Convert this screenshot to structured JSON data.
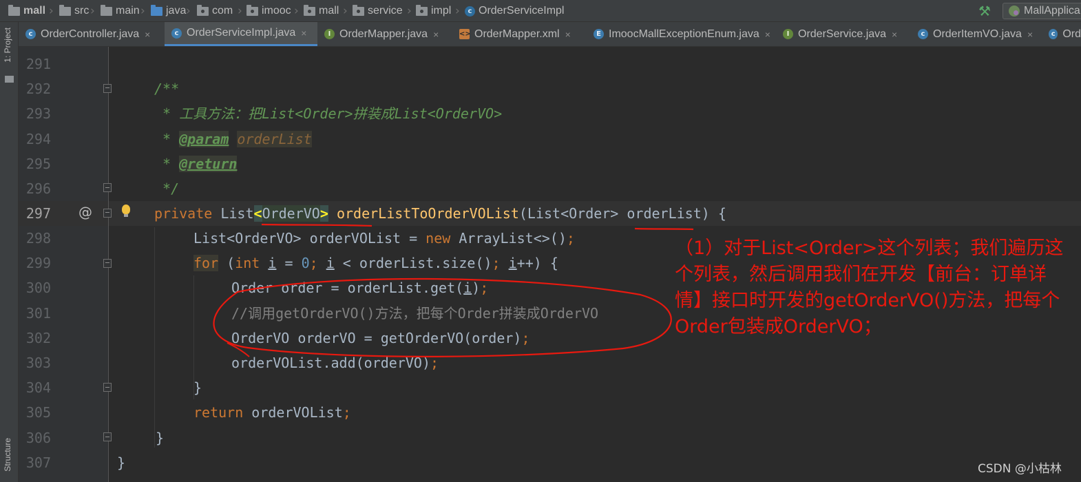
{
  "breadcrumb": {
    "items": [
      "mall",
      "src",
      "main",
      "java",
      "com",
      "imooc",
      "mall",
      "service",
      "impl",
      "OrderServiceImpl"
    ]
  },
  "toolbar": {
    "run_config": "MallApplica"
  },
  "tabs": [
    {
      "label": "OrderController.java",
      "icon": "class-icon",
      "close": "×"
    },
    {
      "label": "OrderServiceImpl.java",
      "icon": "class-icon",
      "close": "×",
      "active": true
    },
    {
      "label": "OrderMapper.java",
      "icon": "interface-icon",
      "close": "×"
    },
    {
      "label": "OrderMapper.xml",
      "icon": "xml-icon",
      "close": "×"
    },
    {
      "label": "ImoocMallExceptionEnum.java",
      "icon": "enum-icon",
      "close": "×"
    },
    {
      "label": "OrderService.java",
      "icon": "interface-icon",
      "close": "×"
    },
    {
      "label": "OrderItemVO.java",
      "icon": "class-icon",
      "close": "×"
    },
    {
      "label": "Ord",
      "icon": "class-icon"
    }
  ],
  "side": {
    "project_label": "1: Project",
    "structure_label": "Structure"
  },
  "editor": {
    "line_numbers": [
      "291",
      "292",
      "293",
      "294",
      "295",
      "296",
      "297",
      "298",
      "299",
      "300",
      "301",
      "302",
      "303",
      "304",
      "305",
      "306",
      "307"
    ],
    "current_line": "297",
    "code": {
      "l292_doc_open": "/**",
      "l293_doc_star": " * ",
      "l293_doc_text": "工具方法：把List<Order>拼装成List<OrderVO>",
      "l294_doc_star": " * ",
      "l294_tag": "@param",
      "l294_param": "orderList",
      "l295_doc_star": " * ",
      "l295_tag": "@return",
      "l296_doc_close": " */",
      "l297_kw": "private",
      "l297_type": "List",
      "l297_lt": "<",
      "l297_typearg": "OrderVO",
      "l297_gt": ">",
      "l297_method": "orderListToOrderVOList",
      "l297_rest": "(List<Order> orderList) {",
      "l298_a": "List<OrderVO> orderVOList = ",
      "l298_new": "new",
      "l298_b": " ArrayList<>()",
      "l298_semi": ";",
      "l299_for": "for",
      "l299_a": " (",
      "l299_int": "int",
      "l299_i1": "i",
      "l299_b": " = ",
      "l299_zero": "0",
      "l299_semi1": ";",
      "l299_i2": "i",
      "l299_c": " < orderList.size()",
      "l299_semi2": ";",
      "l299_i3": "i",
      "l299_d": "++) {",
      "l300_a": "Order order = orderList.get(",
      "l300_i": "i",
      "l300_b": ")",
      "l300_semi": ";",
      "l301_comment": "//调用getOrderVO()方法，把每个Order拼装成OrderVO",
      "l302_a": "OrderVO orderVO = getOrderVO(order)",
      "l302_semi": ";",
      "l303_a": "orderVOList.add(orderVO)",
      "l303_semi": ";",
      "l304_close": "}",
      "l305_return": "return",
      "l305_a": " orderVOList",
      "l305_semi": ";",
      "l306_close": "}",
      "l307_close": "}"
    },
    "gutter_at": "@"
  },
  "annotation": {
    "text": "（1）对于List<Order>这个列表；我们遍历这个列表，然后调用我们在开发【前台：订单详情】接口时开发的getOrderVO()方法，把每个Order包装成OrderVO；",
    "color": "#e8190f"
  },
  "watermark": "CSDN @小枯林",
  "colors": {
    "keyword": "#cc7832",
    "method": "#ffc66d",
    "number": "#6897bb",
    "doc": "#629755",
    "comment": "#808080",
    "text": "#a9b7c6"
  }
}
